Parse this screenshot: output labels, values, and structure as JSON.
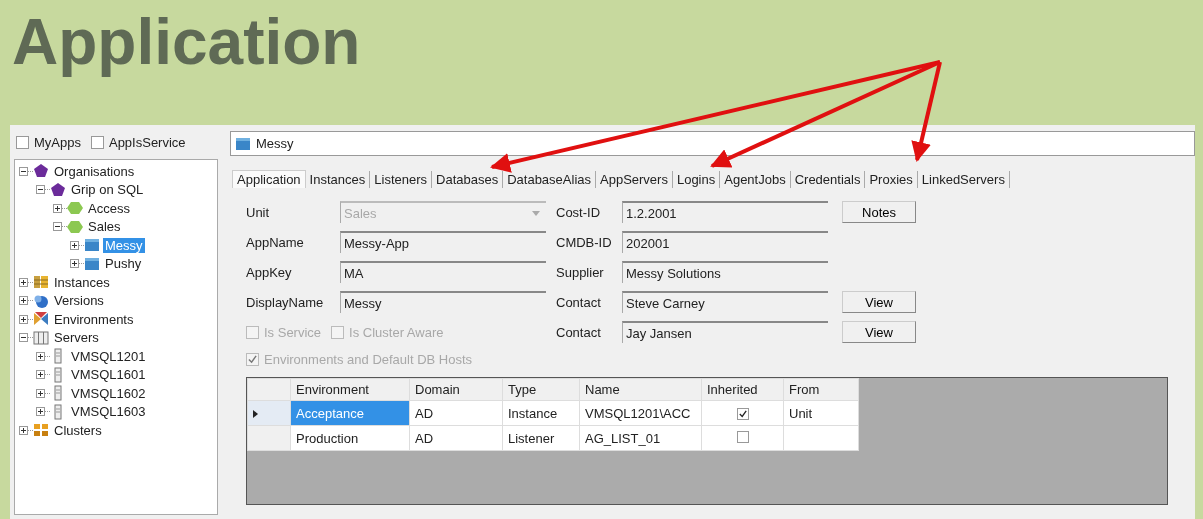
{
  "title": "Application",
  "filters": [
    {
      "label": "MyApps",
      "checked": false
    },
    {
      "label": "AppIsService",
      "checked": false
    }
  ],
  "tree": [
    {
      "label": "Organisations",
      "kind": "org",
      "expanded": true,
      "selected": false,
      "children": [
        {
          "label": "Grip on SQL",
          "kind": "org",
          "expanded": true,
          "selected": false,
          "children": [
            {
              "label": "Access",
              "kind": "unit",
              "expanded": false,
              "selected": false
            },
            {
              "label": "Sales",
              "kind": "unit",
              "expanded": true,
              "selected": false,
              "children": [
                {
                  "label": "Messy",
                  "kind": "app",
                  "expanded": false,
                  "selected": true
                },
                {
                  "label": "Pushy",
                  "kind": "app",
                  "expanded": false,
                  "selected": false
                }
              ]
            }
          ]
        }
      ]
    },
    {
      "label": "Instances",
      "kind": "instances",
      "expanded": false,
      "selected": false
    },
    {
      "label": "Versions",
      "kind": "versions",
      "expanded": false,
      "selected": false
    },
    {
      "label": "Environments",
      "kind": "environments",
      "expanded": false,
      "selected": false
    },
    {
      "label": "Servers",
      "kind": "servers",
      "expanded": true,
      "selected": false,
      "children": [
        {
          "label": "VMSQL1201",
          "kind": "server",
          "expanded": false,
          "selected": false
        },
        {
          "label": "VMSQL1601",
          "kind": "server",
          "expanded": false,
          "selected": false
        },
        {
          "label": "VMSQL1602",
          "kind": "server",
          "expanded": false,
          "selected": false
        },
        {
          "label": "VMSQL1603",
          "kind": "server",
          "expanded": false,
          "selected": false
        }
      ]
    },
    {
      "label": "Clusters",
      "kind": "clusters",
      "expanded": false,
      "selected": false
    }
  ],
  "header": {
    "title": "Messy"
  },
  "tabs": [
    {
      "label": "Application",
      "selected": true
    },
    {
      "label": "Instances",
      "selected": false
    },
    {
      "label": "Listeners",
      "selected": false
    },
    {
      "label": "Databases",
      "selected": false
    },
    {
      "label": "DatabaseAlias",
      "selected": false
    },
    {
      "label": "AppServers",
      "selected": false
    },
    {
      "label": "Logins",
      "selected": false
    },
    {
      "label": "AgentJobs",
      "selected": false
    },
    {
      "label": "Credentials",
      "selected": false
    },
    {
      "label": "Proxies",
      "selected": false
    },
    {
      "label": "LinkedServers",
      "selected": false
    }
  ],
  "form_left": [
    {
      "label": "Unit",
      "value": "Sales",
      "kind": "dropdown",
      "disabled": true
    },
    {
      "label": "AppName",
      "value": "Messy-App",
      "kind": "text",
      "disabled": false
    },
    {
      "label": "AppKey",
      "value": "MA",
      "kind": "text",
      "disabled": false
    },
    {
      "label": "DisplayName",
      "value": "Messy",
      "kind": "text",
      "disabled": false
    }
  ],
  "form_right": [
    {
      "label": "Cost-ID",
      "value": "1.2.2001",
      "button": "Notes"
    },
    {
      "label": "CMDB-ID",
      "value": "202001"
    },
    {
      "label": "Supplier",
      "value": "Messy Solutions"
    },
    {
      "label": "Contact",
      "value": "Steve Carney",
      "button": "View"
    },
    {
      "label": "Contact",
      "value": "Jay Jansen",
      "button": "View"
    }
  ],
  "options": [
    {
      "label": "Is Service",
      "checked": false,
      "disabled": true
    },
    {
      "label": "Is Cluster Aware",
      "checked": false,
      "disabled": true
    }
  ],
  "hosts_option": {
    "label": "Environments and Default DB Hosts",
    "checked": true,
    "disabled": true
  },
  "grid": {
    "columns": [
      "Environment",
      "Domain",
      "Type",
      "Name",
      "Inherited",
      "From"
    ],
    "rows": [
      {
        "current": true,
        "environment": "Acceptance",
        "environment_selected": true,
        "domain": "AD",
        "type": "Instance",
        "name": "VMSQL1201\\ACC",
        "inherited": true,
        "from": "Unit"
      },
      {
        "current": false,
        "environment": "Production",
        "environment_selected": false,
        "domain": "AD",
        "type": "Listener",
        "name": "AG_LIST_01",
        "inherited": false
      }
    ]
  }
}
